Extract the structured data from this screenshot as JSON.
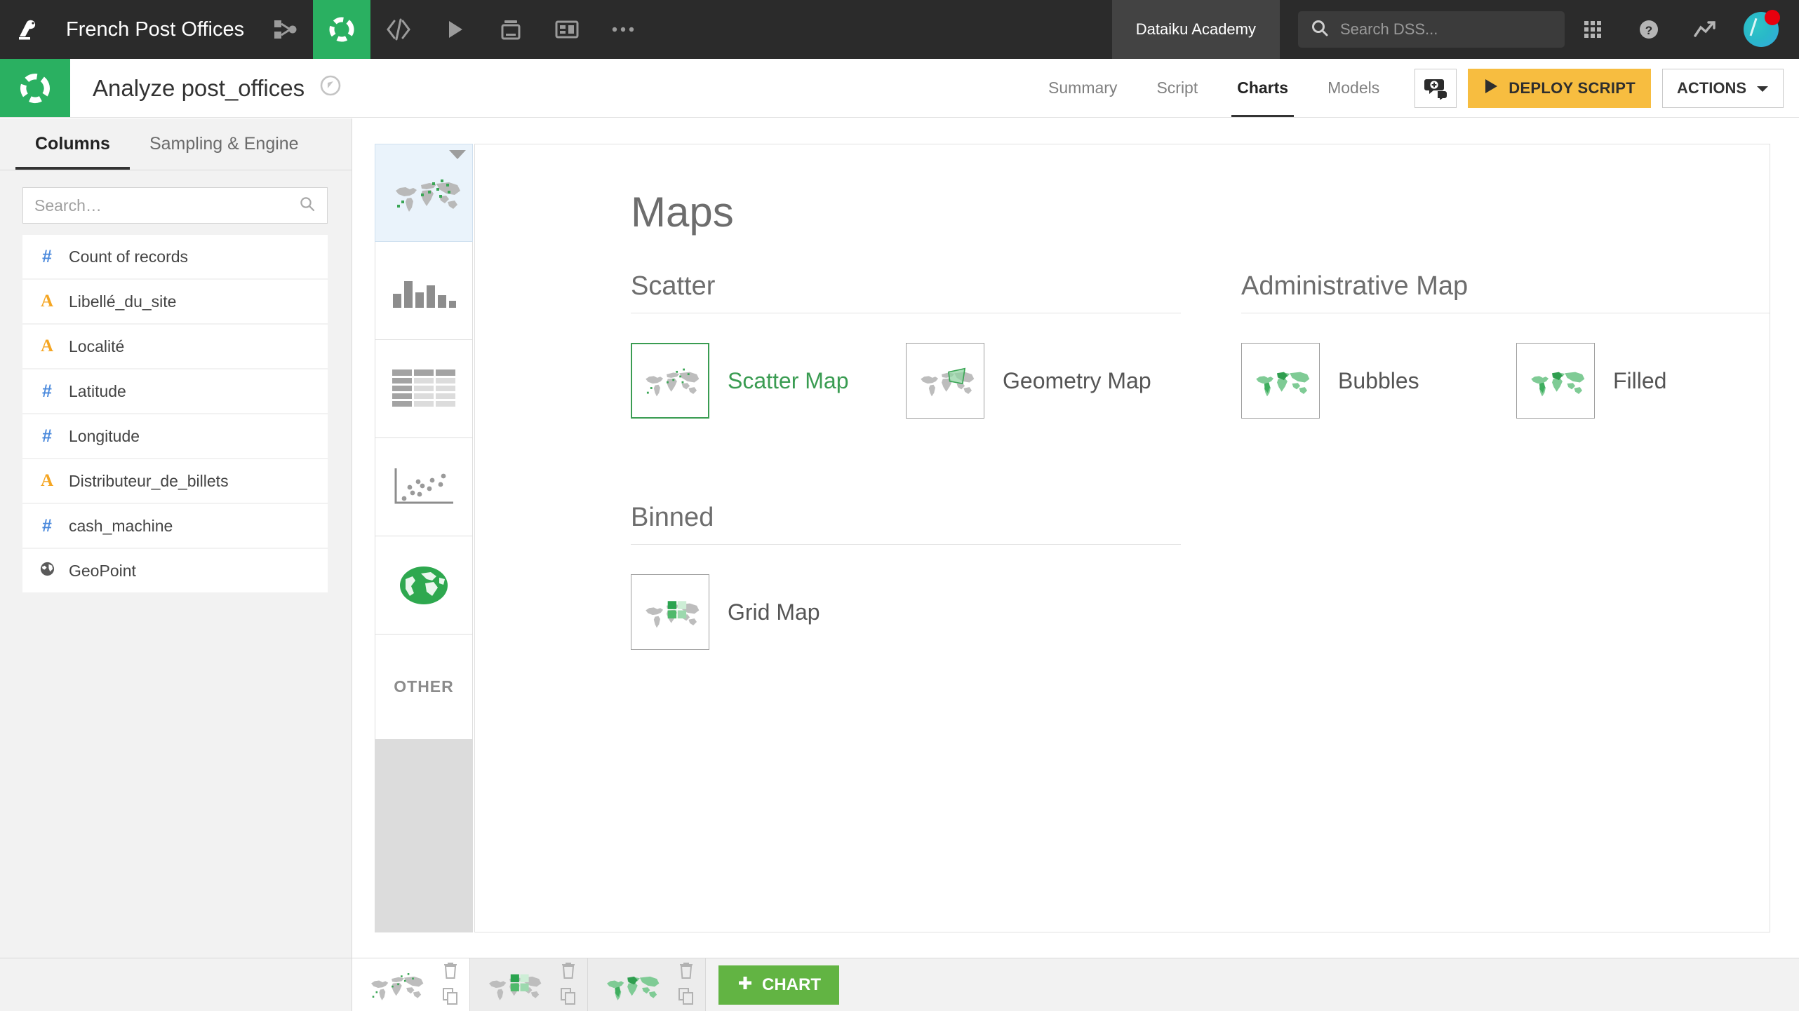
{
  "topbar": {
    "logo_icon": "dataiku-bird-logo",
    "project_name": "French Post Offices",
    "nav_icons": [
      {
        "name": "flow-icon",
        "label": "Flow"
      },
      {
        "name": "lab-icon",
        "label": "Lab",
        "active": true
      },
      {
        "name": "code-icon",
        "label": "Code"
      },
      {
        "name": "run-icon",
        "label": "Run"
      },
      {
        "name": "jobs-icon",
        "label": "Jobs"
      },
      {
        "name": "dashboard-icon",
        "label": "Dashboards"
      },
      {
        "name": "more-icon",
        "label": "More"
      }
    ],
    "academy_label": "Dataiku Academy",
    "search": {
      "placeholder": "Search DSS...",
      "value": "",
      "icon": "search-icon"
    },
    "apps_icon": "apps-grid-icon",
    "help_icon": "help-question-icon",
    "activity_icon": "trend-arrow-icon",
    "avatar_icon": "user-avatar",
    "notification_badge_color": "#e8000d"
  },
  "subheader": {
    "logo_icon": "lab-circle-logo",
    "title": "Analyze post_offices",
    "title_badge_icon": "compass-icon",
    "tabs": [
      {
        "label": "Summary",
        "active": false
      },
      {
        "label": "Script",
        "active": false
      },
      {
        "label": "Charts",
        "active": true
      },
      {
        "label": "Models",
        "active": false
      }
    ],
    "discuss_icon": "discussion-add-icon",
    "deploy_label": "DEPLOY SCRIPT",
    "deploy_icon": "play-icon",
    "deploy_color": "#f7bd40",
    "actions_label": "ACTIONS",
    "actions_caret_icon": "chevron-down-icon"
  },
  "sidebar": {
    "tabs": [
      {
        "label": "Columns",
        "active": true
      },
      {
        "label": "Sampling & Engine",
        "active": false
      }
    ],
    "search": {
      "placeholder": "Search…",
      "value": "",
      "icon": "search-icon"
    },
    "columns": [
      {
        "name": "Count of records",
        "type": "number",
        "icon": "#"
      },
      {
        "name": "Libellé_du_site",
        "type": "text",
        "icon": "A"
      },
      {
        "name": "Localité",
        "type": "text",
        "icon": "A"
      },
      {
        "name": "Latitude",
        "type": "number",
        "icon": "#"
      },
      {
        "name": "Longitude",
        "type": "number",
        "icon": "#"
      },
      {
        "name": "Distributeur_de_billets",
        "type": "text",
        "icon": "A"
      },
      {
        "name": "cash_machine",
        "type": "number",
        "icon": "#"
      },
      {
        "name": "GeoPoint",
        "type": "geo",
        "icon": "globe"
      }
    ]
  },
  "rail": {
    "items": [
      {
        "name": "maps-category",
        "icon": "world-map-scatter-icon",
        "selected": true,
        "has_caret": true
      },
      {
        "name": "basic-charts-category",
        "icon": "bar-chart-icon",
        "selected": false
      },
      {
        "name": "tables-category",
        "icon": "table-icon",
        "selected": false
      },
      {
        "name": "scatter-category",
        "icon": "scatter-plot-icon",
        "selected": false
      },
      {
        "name": "geographic-category",
        "icon": "green-globe-icon",
        "selected": false
      }
    ],
    "other_label": "OTHER"
  },
  "main": {
    "title": "Maps",
    "sections": [
      {
        "title": "Scatter",
        "column": "left",
        "options": [
          {
            "label": "Scatter Map",
            "icon": "scatter-map-thumb",
            "selected": true
          },
          {
            "label": "Geometry Map",
            "icon": "geometry-map-thumb",
            "selected": false
          }
        ]
      },
      {
        "title": "Binned",
        "column": "left",
        "options": [
          {
            "label": "Grid Map",
            "icon": "grid-map-thumb",
            "selected": false
          }
        ]
      },
      {
        "title": "Administrative Map",
        "column": "right",
        "options": [
          {
            "label": "Bubbles",
            "icon": "bubbles-map-thumb",
            "selected": false
          },
          {
            "label": "Filled",
            "icon": "filled-map-thumb",
            "selected": false
          }
        ]
      }
    ]
  },
  "bottombar": {
    "chart_tabs": [
      {
        "icon": "scatter-map-thumb",
        "active": true,
        "delete_icon": "trash-icon",
        "copy_icon": "copy-icon"
      },
      {
        "icon": "grid-map-thumb",
        "active": false,
        "delete_icon": "trash-icon",
        "copy_icon": "copy-icon"
      },
      {
        "icon": "filled-map-thumb",
        "active": false,
        "delete_icon": "trash-icon",
        "copy_icon": "copy-icon"
      }
    ],
    "add_chart_label": "CHART",
    "add_chart_icon": "plus-icon",
    "add_chart_color": "#62b443"
  },
  "colors": {
    "brand_green": "#2ab061",
    "accent_yellow": "#f7bd40",
    "selected_green": "#3a9c52",
    "add_green": "#62b443",
    "topbar_dark": "#2b2b2b"
  }
}
